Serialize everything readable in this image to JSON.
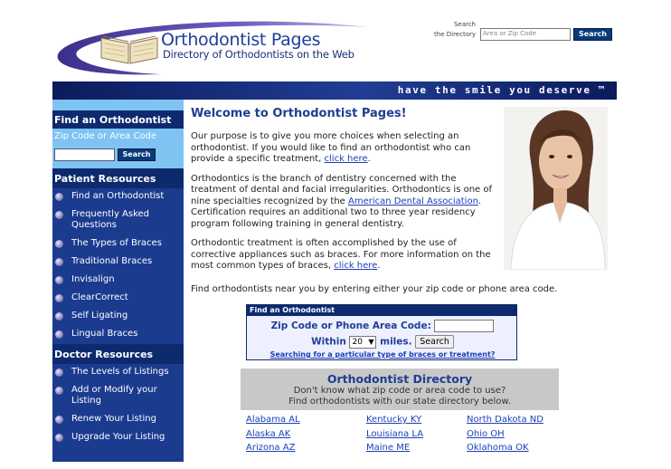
{
  "header": {
    "logo_title": "Orthodontist Pages",
    "logo_subtitle": "Directory of Orthodontists on the Web",
    "search_label_line1": "Search",
    "search_label_line2": "the Directory",
    "search_placeholder": "Area or Zip Code",
    "search_button": "Search"
  },
  "banner": {
    "tagline": "have the smile you deserve ™"
  },
  "sidebar": {
    "find_heading": "Find an Orthodontist",
    "find_label": "Zip Code or Area Code",
    "find_button": "Search",
    "patient_heading": "Patient Resources",
    "patient_items": [
      "Find an Orthodontist",
      "Frequently Asked Questions",
      "The Types of Braces",
      "Traditional Braces",
      "Invisalign",
      "ClearCorrect",
      "Self Ligating",
      "Lingual Braces"
    ],
    "doctor_heading": "Doctor Resources",
    "doctor_items": [
      "The Levels of Listings",
      "Add or Modify your Listing",
      "Renew Your Listing",
      "Upgrade Your Listing"
    ]
  },
  "main": {
    "welcome": "Welcome to Orthodontist Pages!",
    "p1_text": "Our purpose is to give you more choices when selecting an orthodontist.  If you would like to find an orthodontist who can provide a specific treatment, ",
    "p1_link": "click here",
    "p1_end": ".",
    "p2_text": "Orthodontics is the branch of dentistry concerned with the treatment of dental and facial irregularities. Orthodontics is one of nine specialties recognized by the ",
    "p2_link": "American Dental Association",
    "p2_end": ". Certification requires an additional two to three year residency program following training in general dentistry.",
    "p3_text": "Orthodontic treatment is often accomplished by the use of corrective appliances such as braces. For more information on the most common types of braces, ",
    "p3_link": "click here",
    "p3_end": ".",
    "p4_text": "Find orthodontists near you by entering either your zip code or phone area code."
  },
  "findbox": {
    "heading": "Find an Orthodontist",
    "zip_label": "Zip Code or Phone Area Code:",
    "within_label": "Within",
    "miles_value": "20",
    "miles_label": "miles.",
    "search_button": "Search",
    "link": "Searching for a particular type of braces or treatment?"
  },
  "directory": {
    "title": "Orthodontist Directory",
    "sub1": "Don't know what zip code or area code to use?",
    "sub2": "Find orthodontists with our state directory below.",
    "col1": [
      "Alabama AL",
      "Alaska AK",
      "Arizona AZ"
    ],
    "col2": [
      "Kentucky KY",
      "Louisiana LA",
      "Maine ME"
    ],
    "col3": [
      "North Dakota ND",
      "Ohio OH",
      "Oklahoma OK"
    ]
  },
  "colors": {
    "brand_navy": "#0e2a6e",
    "sidebar_blue": "#1b3b8f",
    "light_blue": "#7ec3f2",
    "link_blue": "#1a3fb5",
    "heading_blue": "#1f3e91"
  }
}
